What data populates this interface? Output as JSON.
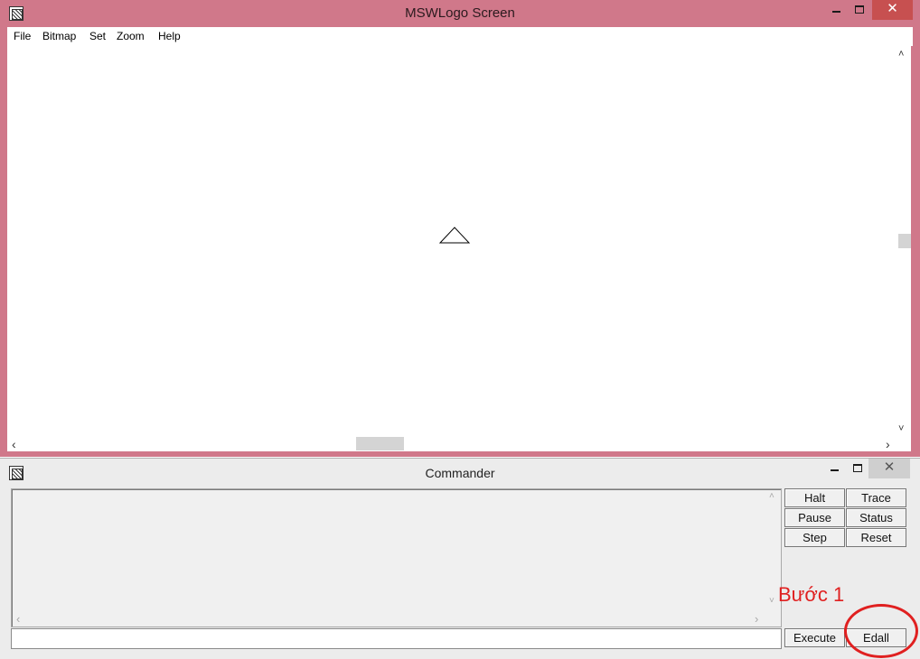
{
  "main_window": {
    "title": "MSWLogo Screen",
    "controls": {
      "minimize": "–",
      "close": "✕"
    },
    "menu": [
      "File",
      "Bitmap",
      "Set",
      "Zoom",
      "Help"
    ],
    "scroll_arrows": {
      "up": "˄",
      "down": "˅",
      "left": "‹",
      "right": "›"
    }
  },
  "commander_window": {
    "title": "Commander",
    "controls": {
      "minimize": "–",
      "close": "✕"
    },
    "buttons": {
      "halt": "Halt",
      "trace": "Trace",
      "pause": "Pause",
      "status": "Status",
      "step": "Step",
      "reset": "Reset",
      "execute": "Execute",
      "edall": "Edall"
    },
    "input_value": "",
    "output_arrows": {
      "up": "˄",
      "down": "˅",
      "left": "‹",
      "right": "›"
    }
  },
  "annotation": {
    "label": "Bước 1",
    "color": "#e02020"
  },
  "colors": {
    "main_frame": "#d0788a",
    "commander_bg": "#ececec"
  },
  "icons": {
    "window_icon": "logo-app-icon",
    "turtle": "turtle-triangle-icon"
  }
}
